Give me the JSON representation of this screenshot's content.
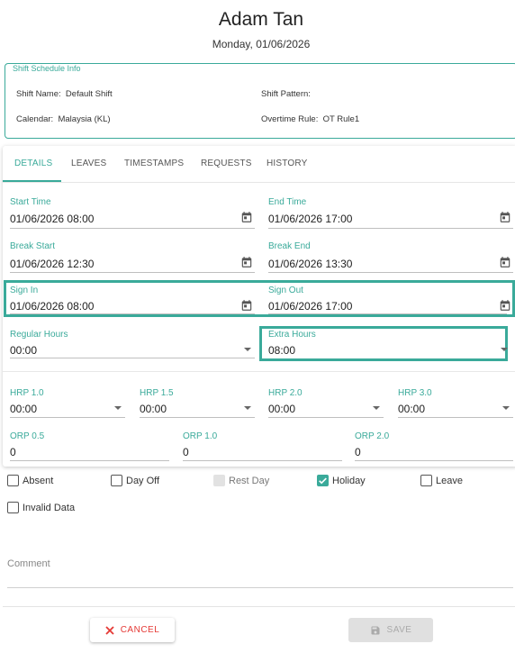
{
  "header": {
    "name": "Adam Tan",
    "date": "Monday, 01/06/2026"
  },
  "shift_info": {
    "legend": "Shift Schedule Info",
    "shift_name_label": "Shift Name:",
    "shift_name": "Default Shift",
    "shift_pattern_label": "Shift Pattern:",
    "shift_pattern": "",
    "calendar_label": "Calendar:",
    "calendar": "Malaysia (KL)",
    "overtime_rule_label": "Overtime Rule:",
    "overtime_rule": "OT Rule1"
  },
  "tabs": [
    {
      "label": "DETAILS",
      "active": true
    },
    {
      "label": "LEAVES",
      "active": false
    },
    {
      "label": "TIMESTAMPS",
      "active": false
    },
    {
      "label": "REQUESTS",
      "active": false
    },
    {
      "label": "HISTORY",
      "active": false
    }
  ],
  "details": {
    "start_time": {
      "label": "Start Time",
      "value": "01/06/2026 08:00"
    },
    "end_time": {
      "label": "End Time",
      "value": "01/06/2026 17:00"
    },
    "break_start": {
      "label": "Break Start",
      "value": "01/06/2026 12:30"
    },
    "break_end": {
      "label": "Break End",
      "value": "01/06/2026 13:30"
    },
    "sign_in": {
      "label": "Sign In",
      "value": "01/06/2026 08:00"
    },
    "sign_out": {
      "label": "Sign Out",
      "value": "01/06/2026 17:00"
    },
    "regular_hours": {
      "label": "Regular Hours",
      "value": "00:00"
    },
    "extra_hours": {
      "label": "Extra Hours",
      "value": "08:00"
    }
  },
  "hrp": [
    {
      "label": "HRP 1.0",
      "value": "00:00"
    },
    {
      "label": "HRP 1.5",
      "value": "00:00"
    },
    {
      "label": "HRP 2.0",
      "value": "00:00"
    },
    {
      "label": "HRP 3.0",
      "value": "00:00"
    }
  ],
  "orp": [
    {
      "label": "ORP 0.5",
      "value": "0"
    },
    {
      "label": "ORP 1.0",
      "value": "0"
    },
    {
      "label": "ORP 2.0",
      "value": "0"
    }
  ],
  "checkboxes": [
    {
      "label": "Absent",
      "checked": false,
      "disabled": false
    },
    {
      "label": "Day Off",
      "checked": false,
      "disabled": false
    },
    {
      "label": "Rest Day",
      "checked": false,
      "disabled": true
    },
    {
      "label": "Holiday",
      "checked": true,
      "disabled": false
    },
    {
      "label": "Leave",
      "checked": false,
      "disabled": false
    },
    {
      "label": "Invalid Data",
      "checked": false,
      "disabled": false
    }
  ],
  "comment": {
    "placeholder": "Comment",
    "value": ""
  },
  "actions": {
    "cancel_label": "CANCEL",
    "save_label": "SAVE"
  },
  "icons": {
    "date_picker": "calendar-icon",
    "dropdown": "dropdown-arrow-icon",
    "cancel": "close-icon",
    "save": "save-icon",
    "checked": "checkmark-icon"
  },
  "colors": {
    "accent": "#3aaa9a",
    "cancel": "#e53935",
    "disabled": "#e0e0e0"
  }
}
